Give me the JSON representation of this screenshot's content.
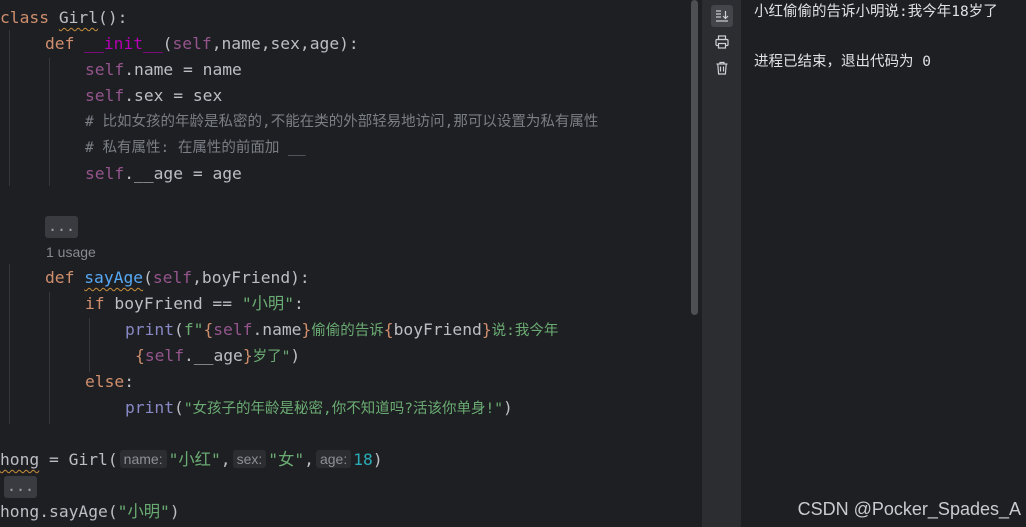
{
  "editor": {
    "l1": {
      "kw": "class",
      "name": "Girl",
      "rest": "():"
    },
    "l2": {
      "kw": "def",
      "fn": "__init__",
      "p1": "(",
      "self": "self",
      "params": ",name,sex,age):"
    },
    "l3": {
      "self": "self",
      "rest": ".name = name"
    },
    "l4": {
      "self": "self",
      "rest": ".sex = sex"
    },
    "l5": {
      "comment": "# 比如女孩的年龄是私密的,不能在类的外部轻易地访问,那可以设置为私有属性"
    },
    "l6": {
      "comment": "# 私有属性: 在属性的前面加 __"
    },
    "l7": {
      "self": "self",
      "rest": ".__age = age"
    },
    "l8": {
      "fold": "..."
    },
    "l9": {
      "usage": "1 usage"
    },
    "l10": {
      "kw": "def",
      "fn": "sayAge",
      "p1": "(",
      "self": "self",
      "params": ",boyFriend):"
    },
    "l11": {
      "kw": "if",
      "mid": " boyFriend == ",
      "str": "\"小明\"",
      "end": ":"
    },
    "l12": {
      "print": "print",
      "p1": "(",
      "f": "f\"",
      "b1": "{",
      "self": "self",
      "attr": ".name",
      "b2": "}",
      "mid": "偷偷的告诉",
      "b3": "{",
      "var": "boyFriend",
      "b4": "}",
      "tail": "说:我今年"
    },
    "l13": {
      "b1": "{",
      "self": "self",
      "attr": ".__age",
      "b2": "}",
      "tail": "岁了\"",
      "close": ")"
    },
    "l14": {
      "kw": "else",
      "end": ":"
    },
    "l15": {
      "print": "print",
      "p1": "(",
      "str": "\"女孩子的年龄是秘密,你不知道吗?活该你单身!\"",
      "close": ")"
    },
    "l16": {
      "var": "hong",
      "eq": " = ",
      "cls": "Girl",
      "p1": "(",
      "h1": "name:",
      "s1": "\"小红\"",
      "c1": ",",
      "h2": "sex:",
      "s2": "\"女\"",
      "c2": ",",
      "h3": "age:",
      "n3": "18",
      "close": ")"
    },
    "l17": {
      "fold": "..."
    },
    "l18": {
      "code": "hong.sayAge(",
      "str": "\"小明\"",
      "close": ")"
    }
  },
  "console": {
    "output1": "小红偷偷的告诉小明说:我今年18岁了",
    "output2": "进程已结束，退出代码为 0"
  },
  "gutter_icons": [
    "scroll-to-end-icon",
    "print-icon",
    "trash-icon"
  ],
  "watermark": "CSDN @Pocker_Spades_A",
  "colors": {
    "background": "#1e1f22",
    "keyword": "#cf8e6d",
    "function": "#56a8f5",
    "self": "#94558d",
    "string": "#6aab73",
    "comment": "#7a7e85",
    "dunder": "#b200b2",
    "number": "#2aacb8"
  }
}
